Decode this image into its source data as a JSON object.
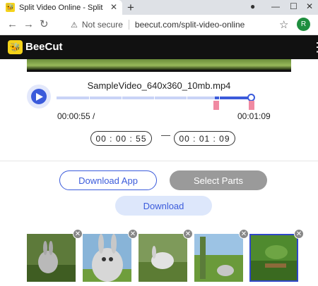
{
  "browser": {
    "tab_title": "Split Video Online - Split Any Vid",
    "tab_favicon": "BeeCut",
    "new_tab_icon": "+",
    "not_secure_label": "Not secure",
    "url": "beecut.com/split-video-online",
    "avatar_letter": "R"
  },
  "app": {
    "brand": "BeeCut"
  },
  "editor": {
    "filename": "SampleVideo_640x360_10mb.mp4",
    "current_time": "00:00:55 /",
    "end_time": "00:01:09",
    "start_box": "00 : 00 : 55",
    "end_box": "00 : 01 : 09",
    "range_separator": "—",
    "progress": 0.8
  },
  "buttons": {
    "download_app": "Download App",
    "select_parts": "Select Parts",
    "download": "Download"
  },
  "thumbnails": [
    {
      "id": "thumb-1",
      "selected": false
    },
    {
      "id": "thumb-2",
      "selected": false
    },
    {
      "id": "thumb-3",
      "selected": false
    },
    {
      "id": "thumb-4",
      "selected": false
    },
    {
      "id": "thumb-5",
      "selected": true
    }
  ],
  "colors": {
    "accent": "#3b5bdb",
    "brand_yellow": "#f5d31a",
    "marker_pink": "#f08aa2"
  }
}
